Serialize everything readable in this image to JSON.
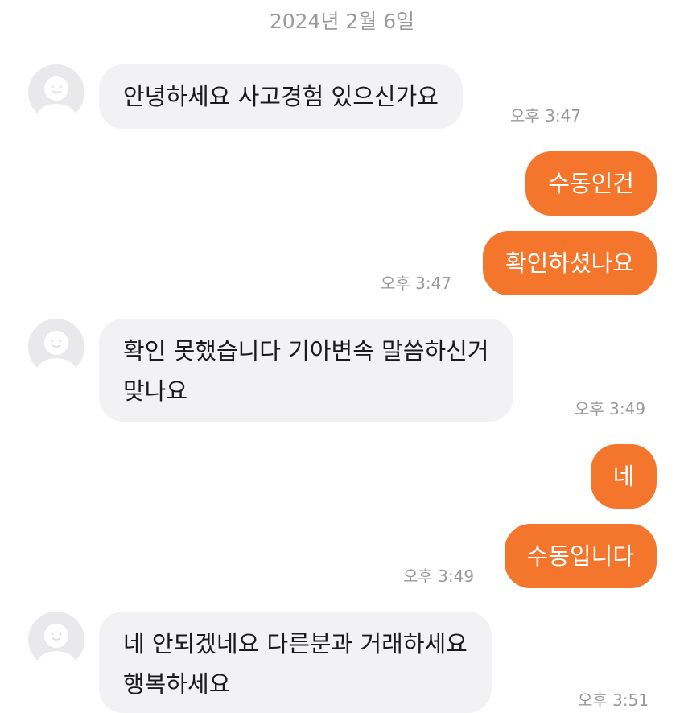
{
  "chat": {
    "date_header": "2024년 2월 6일",
    "messages": [
      {
        "sender": "them",
        "lines": [
          "안녕하세요  사고경험 있으신가요"
        ],
        "time": "오후 3:47"
      },
      {
        "sender": "me",
        "lines": [
          "수동인건"
        ]
      },
      {
        "sender": "me",
        "lines": [
          "확인하셨나요"
        ],
        "time": "오후 3:47"
      },
      {
        "sender": "them",
        "lines": [
          "확인 못했습니다  기아변속 말씀하신거",
          "맞나요"
        ],
        "time": "오후 3:49"
      },
      {
        "sender": "me",
        "lines": [
          "네"
        ]
      },
      {
        "sender": "me",
        "lines": [
          "수동입니다"
        ],
        "time": "오후 3:49"
      },
      {
        "sender": "them",
        "lines": [
          "네  안되겠네요   다른분과  거래하세요",
          "행복하세요"
        ],
        "time": "오후 3:51"
      }
    ]
  },
  "colors": {
    "outgoing_bubble": "#f3762c",
    "incoming_bubble": "#f2f2f5",
    "timestamp_text": "#9a9a9e"
  }
}
